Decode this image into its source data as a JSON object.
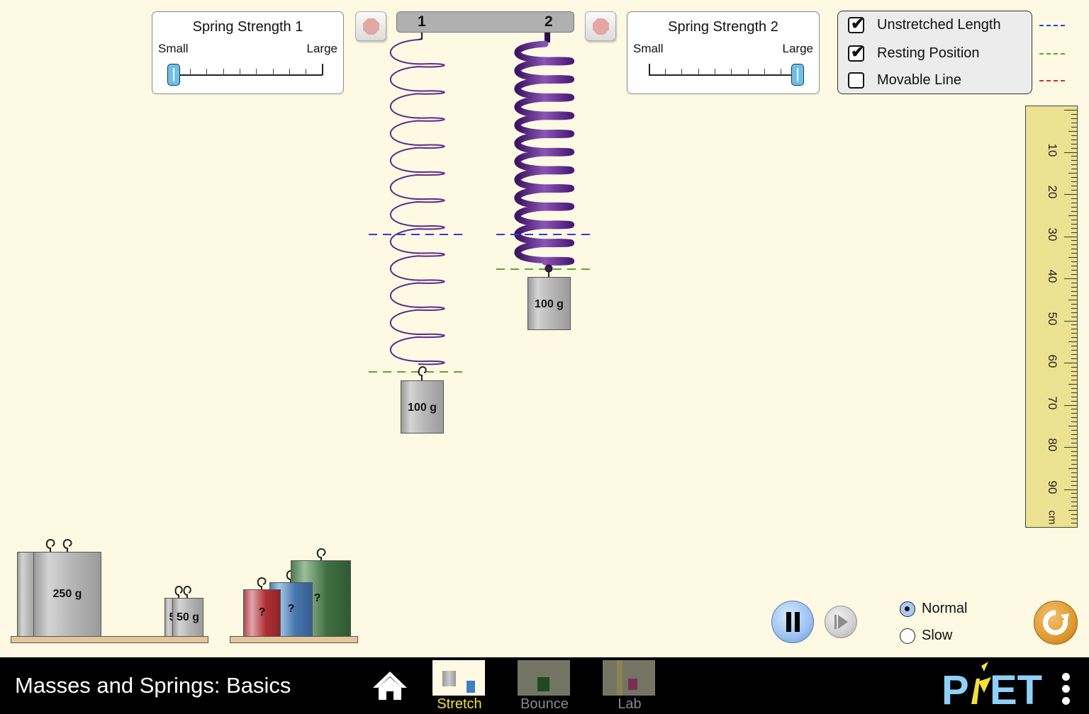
{
  "spring_strength_1": {
    "title": "Spring Strength 1",
    "min_label": "Small",
    "max_label": "Large",
    "value_fraction": 0.0
  },
  "spring_strength_2": {
    "title": "Spring Strength 2",
    "min_label": "Small",
    "max_label": "Large",
    "value_fraction": 1.0
  },
  "springs": {
    "label_1": "1",
    "label_2": "2",
    "mass_1_label": "100 g",
    "mass_2_label": "100 g"
  },
  "stop_buttons": {
    "icon_1": "stop-octagon-icon",
    "icon_2": "stop-octagon-icon"
  },
  "legend": {
    "items": [
      {
        "label": "Unstretched Length",
        "checked": true,
        "color": "#2b3ce0"
      },
      {
        "label": "Resting Position",
        "checked": true,
        "color": "#5aa832"
      },
      {
        "label": "Movable Line",
        "checked": false,
        "color": "#d9301e"
      }
    ],
    "checkmark": "✔"
  },
  "ruler": {
    "labels": [
      "10",
      "20",
      "30",
      "40",
      "50",
      "60",
      "70",
      "80",
      "90"
    ],
    "unit": "cm"
  },
  "mass_shelf": {
    "masses": [
      {
        "label": "250 g"
      },
      {
        "label": "5"
      },
      {
        "label": "50 g"
      }
    ]
  },
  "mystery_shelf": {
    "masses": [
      {
        "label": "?",
        "color": "#a6282d"
      },
      {
        "label": "?",
        "color": "#3c6ba3"
      },
      {
        "label": "?",
        "color": "#366438"
      }
    ]
  },
  "time_controls": {
    "pause_icon": "pause-icon",
    "step_icon": "step-forward-icon",
    "speed_options": [
      {
        "label": "Normal",
        "selected": true
      },
      {
        "label": "Slow",
        "selected": false
      }
    ],
    "reset_icon": "reset-icon"
  },
  "navbar": {
    "title": "Masses and Springs: Basics",
    "home_icon": "home-icon",
    "screens": [
      {
        "label": "Stretch",
        "active": true
      },
      {
        "label": "Bounce",
        "active": false
      },
      {
        "label": "Lab",
        "active": false
      }
    ],
    "brand": "PhET",
    "menu_icon": "kebab-menu-icon"
  },
  "colors": {
    "background": "#fdf9e3",
    "active_tab": "#f2e13a",
    "inactive_tab": "#8a8a8a",
    "spring": "#5e2a8c",
    "reset": "#e09a2e",
    "pause": "#a8cbf5"
  }
}
